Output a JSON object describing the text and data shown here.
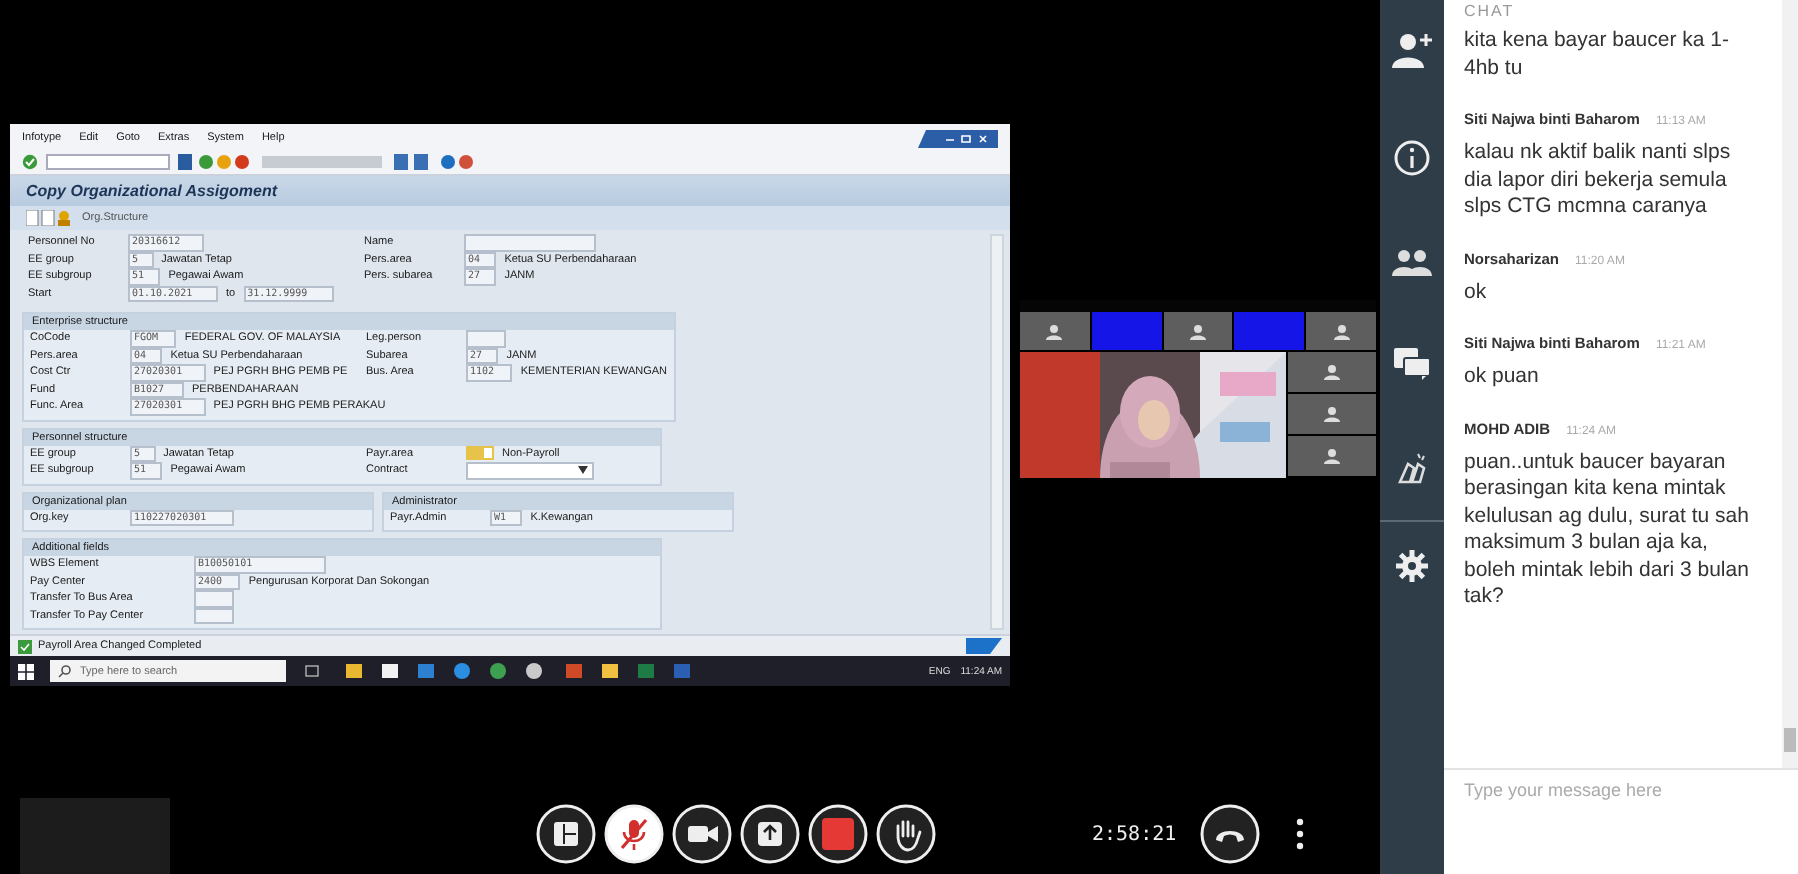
{
  "shared_screen": {
    "menu": [
      "Infotype",
      "Edit",
      "Goto",
      "Extras",
      "System",
      "Help"
    ],
    "title": "Copy Organizational Assigoment",
    "app_toolbar_link": "Org.Structure",
    "blocks": [
      {
        "panels": [
          {
            "rows": [
              {
                "left": [
                  {
                    "kind": "label",
                    "text": "Personnel No"
                  },
                  {
                    "kind": "field",
                    "text": "20316612"
                  }
                ],
                "right": [
                  {
                    "kind": "label",
                    "text": "Name"
                  },
                  {
                    "kind": "long-field"
                  }
                ]
              },
              {
                "left": [
                  {
                    "kind": "label",
                    "text": "EE group"
                  },
                  {
                    "kind": "field",
                    "text": "5"
                  },
                  {
                    "kind": "text",
                    "text": "Jawatan Tetap"
                  }
                ],
                "right": [
                  {
                    "kind": "label",
                    "text": "Pers.area"
                  },
                  {
                    "kind": "field",
                    "text": "04"
                  },
                  {
                    "kind": "text",
                    "text": "Ketua SU Perbendaharaan"
                  }
                ]
              },
              {
                "left": [
                  {
                    "kind": "label",
                    "text": "EE subgroup"
                  },
                  {
                    "kind": "field",
                    "text": "51"
                  },
                  {
                    "kind": "text",
                    "text": "Pegawai Awam"
                  }
                ],
                "right": [
                  {
                    "kind": "label",
                    "text": "Pers. subarea"
                  },
                  {
                    "kind": "field",
                    "text": "27"
                  },
                  {
                    "kind": "text",
                    "text": "JANM"
                  }
                ]
              },
              {
                "left": [
                  {
                    "kind": "label",
                    "text": "Start"
                  },
                  {
                    "kind": "field",
                    "text": "01.10.2021"
                  },
                  {
                    "kind": "text",
                    "text": "to"
                  },
                  {
                    "kind": "field",
                    "text": "31.12.9999"
                  }
                ],
                "right": []
              }
            ]
          }
        ]
      },
      {
        "panels": [
          {
            "title": "Enterprise structure",
            "rows": [
              {
                "left": [
                  {
                    "kind": "label",
                    "text": "CoCode"
                  },
                  {
                    "kind": "field",
                    "text": "FGOM"
                  },
                  {
                    "kind": "text",
                    "text": "FEDERAL GOV. OF MALAYSIA"
                  }
                ],
                "right": [
                  {
                    "kind": "label",
                    "text": "Leg.person"
                  },
                  {
                    "kind": "field"
                  }
                ]
              },
              {
                "left": [
                  {
                    "kind": "label",
                    "text": "Pers.area"
                  },
                  {
                    "kind": "field",
                    "text": "04"
                  },
                  {
                    "kind": "text",
                    "text": "Ketua SU Perbendaharaan"
                  }
                ],
                "right": [
                  {
                    "kind": "label",
                    "text": "Subarea"
                  },
                  {
                    "kind": "field",
                    "text": "27"
                  },
                  {
                    "kind": "text",
                    "text": "JANM"
                  }
                ]
              },
              {
                "left": [
                  {
                    "kind": "label",
                    "text": "Cost Ctr"
                  },
                  {
                    "kind": "field",
                    "text": "27020301"
                  },
                  {
                    "kind": "text",
                    "text": "PEJ PGRH BHG PEMB PE"
                  }
                ],
                "right": [
                  {
                    "kind": "label",
                    "text": "Bus. Area"
                  },
                  {
                    "kind": "field",
                    "text": "1102"
                  },
                  {
                    "kind": "text",
                    "text": "KEMENTERIAN KEWANGAN"
                  }
                ]
              },
              {
                "left": [
                  {
                    "kind": "label",
                    "text": "Fund"
                  },
                  {
                    "kind": "field",
                    "text": "B1027"
                  },
                  {
                    "kind": "text",
                    "text": "PERBENDAHARAAN"
                  }
                ],
                "right": []
              },
              {
                "left": [
                  {
                    "kind": "label",
                    "text": "Func. Area"
                  },
                  {
                    "kind": "field",
                    "text": "27020301"
                  },
                  {
                    "kind": "text",
                    "text": "PEJ PGRH BHG PEMB PERAKAU"
                  }
                ],
                "right": []
              }
            ]
          }
        ]
      },
      {
        "panels": [
          {
            "title": "Personnel structure",
            "rows": [
              {
                "left": [
                  {
                    "kind": "label",
                    "text": "EE group"
                  },
                  {
                    "kind": "field",
                    "text": "5"
                  },
                  {
                    "kind": "text",
                    "text": "Jawatan Tetap"
                  }
                ],
                "right": [
                  {
                    "kind": "label",
                    "text": "Payr.area"
                  },
                  {
                    "kind": "icon-field"
                  },
                  {
                    "kind": "text",
                    "text": "Non-Payroll"
                  }
                ]
              },
              {
                "left": [
                  {
                    "kind": "label",
                    "text": "EE subgroup"
                  },
                  {
                    "kind": "field",
                    "text": "51"
                  },
                  {
                    "kind": "text",
                    "text": "Pegawai Awam"
                  }
                ],
                "right": [
                  {
                    "kind": "label",
                    "text": "Contract"
                  },
                  {
                    "kind": "dropdown"
                  }
                ]
              }
            ]
          }
        ]
      },
      {
        "panels": [
          {
            "title": "Organizational plan",
            "rows": [
              {
                "left": [
                  {
                    "kind": "label",
                    "text": "Org.key"
                  },
                  {
                    "kind": "field",
                    "text": "110227020301"
                  }
                ],
                "right": []
              }
            ]
          },
          {
            "title": "Administrator",
            "rows": [
              {
                "left": [
                  {
                    "kind": "label",
                    "text": "Payr.Admin"
                  },
                  {
                    "kind": "field",
                    "text": "W1"
                  },
                  {
                    "kind": "text",
                    "text": "K.Kewangan"
                  }
                ],
                "right": []
              }
            ]
          }
        ]
      },
      {
        "panels": [
          {
            "title": "Additional fields",
            "rows": [
              {
                "left": [
                  {
                    "kind": "label",
                    "text": "WBS Element"
                  },
                  {
                    "kind": "long-field",
                    "text": "B10050101"
                  }
                ],
                "right": []
              },
              {
                "left": [
                  {
                    "kind": "label",
                    "text": "Pay Center"
                  },
                  {
                    "kind": "field",
                    "text": "2400"
                  },
                  {
                    "kind": "text",
                    "text": "Pengurusan Korporat Dan Sokongan"
                  }
                ],
                "right": []
              },
              {
                "left": [
                  {
                    "kind": "label",
                    "text": "Transfer To Bus Area"
                  },
                  {
                    "kind": "field"
                  }
                ],
                "right": []
              },
              {
                "left": [
                  {
                    "kind": "label",
                    "text": "Transfer To Pay Center"
                  },
                  {
                    "kind": "field"
                  }
                ],
                "right": []
              }
            ]
          }
        ]
      }
    ],
    "status": "Payroll Area Changed Completed",
    "taskbar": {
      "search_placeholder": "Type here to search",
      "language": "ENG",
      "time": "11:24 AM"
    }
  },
  "call": {
    "timer": "2:58:21"
  },
  "chat": {
    "title": "CHAT",
    "messages": [
      {
        "text": "kita kena bayar baucer ka 1-4hb tu"
      },
      {
        "sender": "Siti Najwa binti Baharom",
        "time": "11:13 AM",
        "text": "kalau nk aktif balik nanti slps dia lapor diri bekerja semula slps CTG mcmna caranya"
      },
      {
        "sender": "Norsaharizan",
        "time": "11:20 AM",
        "text": "ok"
      },
      {
        "sender": "Siti Najwa binti Baharom",
        "time": "11:21 AM",
        "text": "ok puan"
      },
      {
        "sender": "MOHD ADIB",
        "time": "11:24 AM",
        "text": "puan..untuk baucer bayaran berasingan kita kena mintak kelulusan ag dulu, surat tu sah maksimum 3 bulan aja ka, boleh mintak lebih dari 3 bulan tak?"
      }
    ],
    "input": {
      "placeholder": "Type your message here"
    }
  }
}
